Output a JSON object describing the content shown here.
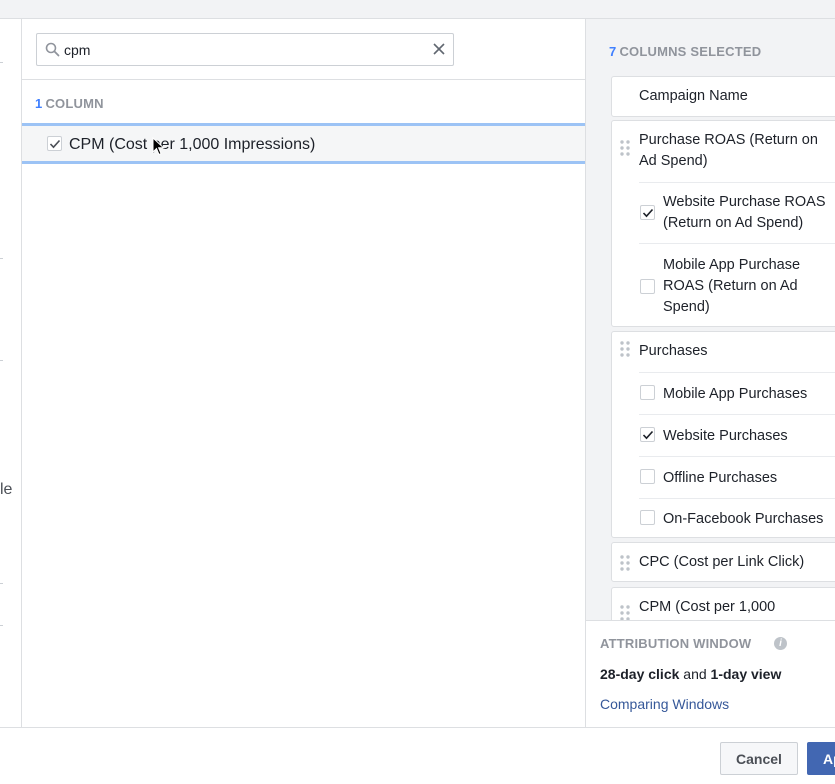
{
  "left_strip": {
    "fragment": "le"
  },
  "search": {
    "value": "cpm",
    "placeholder": "Search"
  },
  "results": {
    "count": "1",
    "count_label": "COLUMN",
    "items": [
      {
        "label": "CPM (Cost per 1,000 Impressions)",
        "checked": true
      }
    ]
  },
  "selected": {
    "count": "7",
    "header": "COLUMNS SELECTED",
    "campaign_name": "Campaign Name",
    "purchase_roas": {
      "title_line1": "Purchase ROAS (Return on",
      "title_line2": "Ad Spend)",
      "website_line1": "Website Purchase ROAS",
      "website_line2": "(Return on Ad Spend)",
      "mobile_line1": "Mobile App Purchase",
      "mobile_line2": "ROAS (Return on Ad",
      "mobile_line3": "Spend)"
    },
    "purchases": {
      "title": "Purchases",
      "mobile": "Mobile App Purchases",
      "website": "Website Purchases",
      "offline": "Offline Purchases",
      "on_facebook": "On-Facebook Purchases"
    },
    "cpc": "CPC (Cost per Link Click)",
    "cpm": "CPM (Cost per 1,000"
  },
  "attribution": {
    "header": "ATTRIBUTION WINDOW",
    "info_glyph": "i",
    "click": "28-day click",
    "and": "and",
    "view": "1-day view",
    "link": "Comparing Windows"
  },
  "footer": {
    "cancel": "Cancel",
    "apply": "Apply"
  },
  "colors": {
    "accent": "#4080ff",
    "link": "#365899",
    "primary_button": "#4267b2",
    "highlight_border": "#9cc3f5"
  }
}
